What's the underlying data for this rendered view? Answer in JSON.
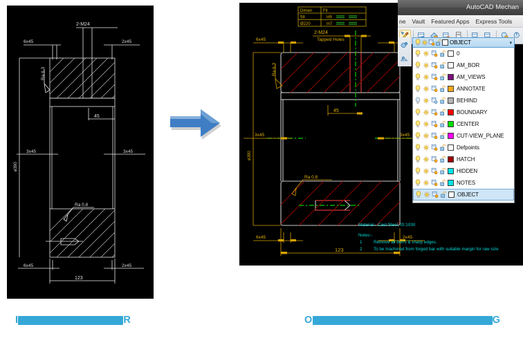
{
  "window": {
    "title": "AutoCAD Mechan",
    "menu_items": [
      "ne",
      "Vault",
      "Featured Apps",
      "Express Tools"
    ],
    "ribbon_icons": [
      "layer-properties-icon",
      "layer-previous-icon",
      "layer-state-icon",
      "layer-make-current-icon",
      "layer-match-icon",
      "layer-isolate-icon",
      "layer-unisolate-icon",
      "layer-freeze-icon",
      "layer-off-icon"
    ],
    "layer_tool_icons": [
      "layer-walk-icon",
      "layer-merge-icon"
    ]
  },
  "layer_panel": {
    "current_layer": "OBJECT",
    "current_layer_color": "#ffffff",
    "dropdown_caret": "▾",
    "row_icons": [
      "lightbulb-icon",
      "sun-icon",
      "freeze-viewport-icon",
      "unlock-padlock-icon"
    ],
    "layers": [
      {
        "name": "0",
        "color": "#ffffff",
        "on": true,
        "selected": false
      },
      {
        "name": "AM_BOR",
        "color": "#ffffff",
        "on": true,
        "selected": false
      },
      {
        "name": "AM_VIEWS",
        "color": "#7b0f7b",
        "on": true,
        "selected": false
      },
      {
        "name": "ANNOTATE",
        "color": "#f5a81c",
        "on": true,
        "selected": false
      },
      {
        "name": "BEHIND",
        "color": "#b6b6b6",
        "on": false,
        "selected": false
      },
      {
        "name": "BOUNDARY",
        "color": "#ff0000",
        "on": true,
        "selected": false
      },
      {
        "name": "CENTER",
        "color": "#00e000",
        "on": true,
        "selected": false
      },
      {
        "name": "CUT-VIEW_PLANE",
        "color": "#ff00ff",
        "on": true,
        "selected": false
      },
      {
        "name": "Defpoints",
        "color": "#ffffff",
        "on": true,
        "selected": false
      },
      {
        "name": "HATCH",
        "color": "#9e0000",
        "on": true,
        "selected": false
      },
      {
        "name": "HIDDEN",
        "color": "#00e6e6",
        "on": true,
        "selected": false
      },
      {
        "name": "NOTES",
        "color": "#00e6e6",
        "on": true,
        "selected": false
      },
      {
        "name": "OBJECT",
        "color": "#ffffff",
        "on": true,
        "selected": true
      }
    ]
  },
  "input_drawing": {
    "label": "monochrome scanned technical drawing",
    "annotations": {
      "top_thread": "2-M24",
      "chamfer_top_left": "6x45",
      "chamfer_top_right": "2x45",
      "chamfer_mid_left": "3x45",
      "chamfer_mid_right": "3x45",
      "chamfer_bot_left": "6x45",
      "chamfer_bot_right": "2x45",
      "roughness_upper": "Ra 6.3",
      "roughness_lower": "Ra  0.8",
      "dim_45": "45",
      "dim_123": "123",
      "dim_diameter": "ø390"
    }
  },
  "output_drawing": {
    "label": "colour-coded layered CAD drawing",
    "table": {
      "headers": [
        "Dimen",
        "Fit"
      ],
      "rows": [
        {
          "dimen": "58",
          "fit": "H9"
        },
        {
          "dimen": "Ø220",
          "fit": "m7"
        }
      ]
    },
    "annotations": {
      "top_thread": "2-M24",
      "top_thread_note": "Tapped Holes",
      "chamfer_top_left": "6x45",
      "chamfer_top_right": "2x45",
      "chamfer_mid_left": "3x45",
      "chamfer_mid_right": "3x45",
      "chamfer_bot_left": "6x45",
      "chamfer_bot_right": "2x45",
      "roughness_upper": "Ra 6.3",
      "roughness_lower": "Ra 0.8",
      "dim_45": "45",
      "dim_123": "123",
      "dim_diameter": "ø390"
    },
    "notes": {
      "material": "Material  - Cast Steel, IS:1030",
      "heading": "Notes:-",
      "items": [
        {
          "num": "1",
          "text": "Remove all burrs & sharp edges."
        },
        {
          "num": "2",
          "text": "To be machined from forged bar with suitable margin for raw size"
        }
      ]
    },
    "colors": {
      "dimension": "#d6a200",
      "hatch": "#b00000",
      "object": "#c8c8c8",
      "center": "#00d000",
      "notes": "#00d8d8",
      "table": "#c8a200",
      "boundary": "#ff3a3a"
    }
  },
  "captions": {
    "left": {
      "prefix": "I",
      "redacted_width": 152,
      "suffix": "R"
    },
    "right": {
      "prefix": "O",
      "redacted_width": 260,
      "suffix": "G"
    },
    "accent_color": "#35a8d8"
  }
}
